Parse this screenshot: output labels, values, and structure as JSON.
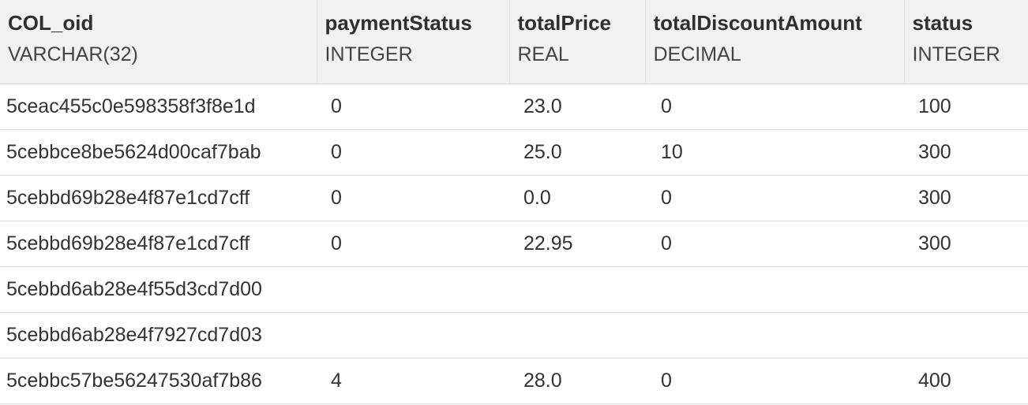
{
  "columns": [
    {
      "name": "COL_oid",
      "type": "VARCHAR(32)"
    },
    {
      "name": "paymentStatus",
      "type": "INTEGER"
    },
    {
      "name": "totalPrice",
      "type": "REAL"
    },
    {
      "name": "totalDiscountAmount",
      "type": "DECIMAL"
    },
    {
      "name": "status",
      "type": "INTEGER"
    }
  ],
  "rows": [
    [
      "5ceac455c0e598358f3f8e1d",
      "0",
      "23.0",
      "0",
      "100"
    ],
    [
      "5cebbce8be5624d00caf7bab",
      "0",
      "25.0",
      "10",
      "300"
    ],
    [
      "5cebbd69b28e4f87e1cd7cff",
      "0",
      "0.0",
      "0",
      "300"
    ],
    [
      "5cebbd69b28e4f87e1cd7cff",
      "0",
      "22.95",
      "0",
      "300"
    ],
    [
      "5cebbd6ab28e4f55d3cd7d00",
      "",
      "",
      "",
      ""
    ],
    [
      "5cebbd6ab28e4f7927cd7d03",
      "",
      "",
      "",
      ""
    ],
    [
      "5cebbc57be56247530af7b86",
      "4",
      "28.0",
      "0",
      "400"
    ]
  ]
}
